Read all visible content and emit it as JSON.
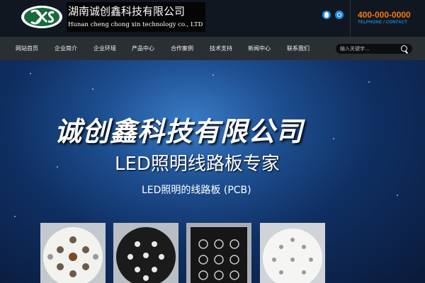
{
  "header": {
    "logo_icon": "cxs-logo-icon",
    "company_name_cn": "湖南诚创鑫科技有限公司",
    "company_name_en": "Hunan cheng chong xin technology co., LTD",
    "phone": "400-000-0000",
    "phone_caption": "TELPHONE / CONTACT",
    "social_icons": [
      "qq-icon",
      "weibo-icon"
    ]
  },
  "nav": {
    "items": [
      {
        "label": "网站首页"
      },
      {
        "label": "企业简介"
      },
      {
        "label": "企业环境"
      },
      {
        "label": "产品中心"
      },
      {
        "label": "合作案例"
      },
      {
        "label": "技术支持"
      },
      {
        "label": "新闻中心"
      },
      {
        "label": "联系我们"
      }
    ],
    "search_placeholder": "输入关键字..."
  },
  "banner": {
    "headline": "诚创鑫科技有限公司",
    "subheadline": "LED照明线路板专家",
    "caption": "LED照明的线路板 (PCB)"
  },
  "colors": {
    "accent_orange": "#f47a0c",
    "accent_blue": "#1a86d0",
    "nav_bg": "#2a2f34",
    "logo_green": "#176b3a"
  }
}
